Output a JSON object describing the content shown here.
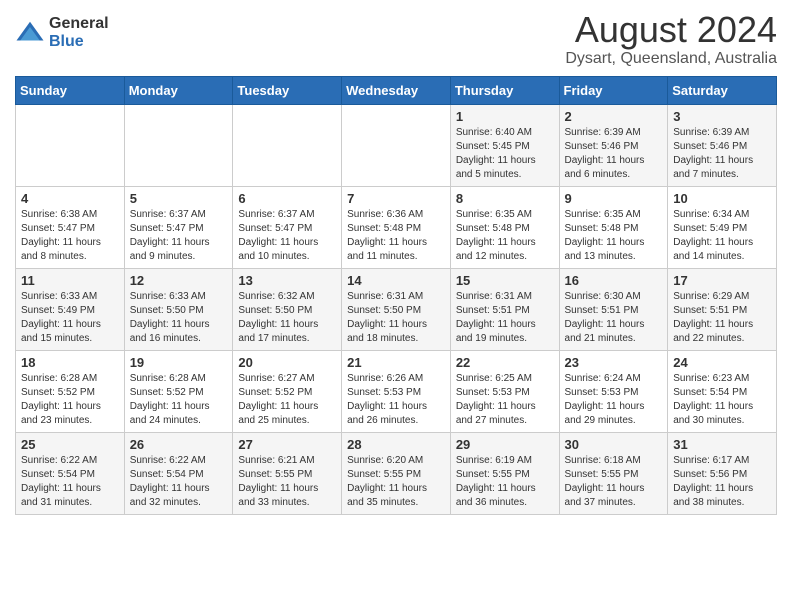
{
  "logo": {
    "general": "General",
    "blue": "Blue"
  },
  "title": "August 2024",
  "subtitle": "Dysart, Queensland, Australia",
  "days_of_week": [
    "Sunday",
    "Monday",
    "Tuesday",
    "Wednesday",
    "Thursday",
    "Friday",
    "Saturday"
  ],
  "weeks": [
    [
      {
        "day": "",
        "info": ""
      },
      {
        "day": "",
        "info": ""
      },
      {
        "day": "",
        "info": ""
      },
      {
        "day": "",
        "info": ""
      },
      {
        "day": "1",
        "info": "Sunrise: 6:40 AM\nSunset: 5:45 PM\nDaylight: 11 hours and 5 minutes."
      },
      {
        "day": "2",
        "info": "Sunrise: 6:39 AM\nSunset: 5:46 PM\nDaylight: 11 hours and 6 minutes."
      },
      {
        "day": "3",
        "info": "Sunrise: 6:39 AM\nSunset: 5:46 PM\nDaylight: 11 hours and 7 minutes."
      }
    ],
    [
      {
        "day": "4",
        "info": "Sunrise: 6:38 AM\nSunset: 5:47 PM\nDaylight: 11 hours and 8 minutes."
      },
      {
        "day": "5",
        "info": "Sunrise: 6:37 AM\nSunset: 5:47 PM\nDaylight: 11 hours and 9 minutes."
      },
      {
        "day": "6",
        "info": "Sunrise: 6:37 AM\nSunset: 5:47 PM\nDaylight: 11 hours and 10 minutes."
      },
      {
        "day": "7",
        "info": "Sunrise: 6:36 AM\nSunset: 5:48 PM\nDaylight: 11 hours and 11 minutes."
      },
      {
        "day": "8",
        "info": "Sunrise: 6:35 AM\nSunset: 5:48 PM\nDaylight: 11 hours and 12 minutes."
      },
      {
        "day": "9",
        "info": "Sunrise: 6:35 AM\nSunset: 5:48 PM\nDaylight: 11 hours and 13 minutes."
      },
      {
        "day": "10",
        "info": "Sunrise: 6:34 AM\nSunset: 5:49 PM\nDaylight: 11 hours and 14 minutes."
      }
    ],
    [
      {
        "day": "11",
        "info": "Sunrise: 6:33 AM\nSunset: 5:49 PM\nDaylight: 11 hours and 15 minutes."
      },
      {
        "day": "12",
        "info": "Sunrise: 6:33 AM\nSunset: 5:50 PM\nDaylight: 11 hours and 16 minutes."
      },
      {
        "day": "13",
        "info": "Sunrise: 6:32 AM\nSunset: 5:50 PM\nDaylight: 11 hours and 17 minutes."
      },
      {
        "day": "14",
        "info": "Sunrise: 6:31 AM\nSunset: 5:50 PM\nDaylight: 11 hours and 18 minutes."
      },
      {
        "day": "15",
        "info": "Sunrise: 6:31 AM\nSunset: 5:51 PM\nDaylight: 11 hours and 19 minutes."
      },
      {
        "day": "16",
        "info": "Sunrise: 6:30 AM\nSunset: 5:51 PM\nDaylight: 11 hours and 21 minutes."
      },
      {
        "day": "17",
        "info": "Sunrise: 6:29 AM\nSunset: 5:51 PM\nDaylight: 11 hours and 22 minutes."
      }
    ],
    [
      {
        "day": "18",
        "info": "Sunrise: 6:28 AM\nSunset: 5:52 PM\nDaylight: 11 hours and 23 minutes."
      },
      {
        "day": "19",
        "info": "Sunrise: 6:28 AM\nSunset: 5:52 PM\nDaylight: 11 hours and 24 minutes."
      },
      {
        "day": "20",
        "info": "Sunrise: 6:27 AM\nSunset: 5:52 PM\nDaylight: 11 hours and 25 minutes."
      },
      {
        "day": "21",
        "info": "Sunrise: 6:26 AM\nSunset: 5:53 PM\nDaylight: 11 hours and 26 minutes."
      },
      {
        "day": "22",
        "info": "Sunrise: 6:25 AM\nSunset: 5:53 PM\nDaylight: 11 hours and 27 minutes."
      },
      {
        "day": "23",
        "info": "Sunrise: 6:24 AM\nSunset: 5:53 PM\nDaylight: 11 hours and 29 minutes."
      },
      {
        "day": "24",
        "info": "Sunrise: 6:23 AM\nSunset: 5:54 PM\nDaylight: 11 hours and 30 minutes."
      }
    ],
    [
      {
        "day": "25",
        "info": "Sunrise: 6:22 AM\nSunset: 5:54 PM\nDaylight: 11 hours and 31 minutes."
      },
      {
        "day": "26",
        "info": "Sunrise: 6:22 AM\nSunset: 5:54 PM\nDaylight: 11 hours and 32 minutes."
      },
      {
        "day": "27",
        "info": "Sunrise: 6:21 AM\nSunset: 5:55 PM\nDaylight: 11 hours and 33 minutes."
      },
      {
        "day": "28",
        "info": "Sunrise: 6:20 AM\nSunset: 5:55 PM\nDaylight: 11 hours and 35 minutes."
      },
      {
        "day": "29",
        "info": "Sunrise: 6:19 AM\nSunset: 5:55 PM\nDaylight: 11 hours and 36 minutes."
      },
      {
        "day": "30",
        "info": "Sunrise: 6:18 AM\nSunset: 5:55 PM\nDaylight: 11 hours and 37 minutes."
      },
      {
        "day": "31",
        "info": "Sunrise: 6:17 AM\nSunset: 5:56 PM\nDaylight: 11 hours and 38 minutes."
      }
    ]
  ]
}
